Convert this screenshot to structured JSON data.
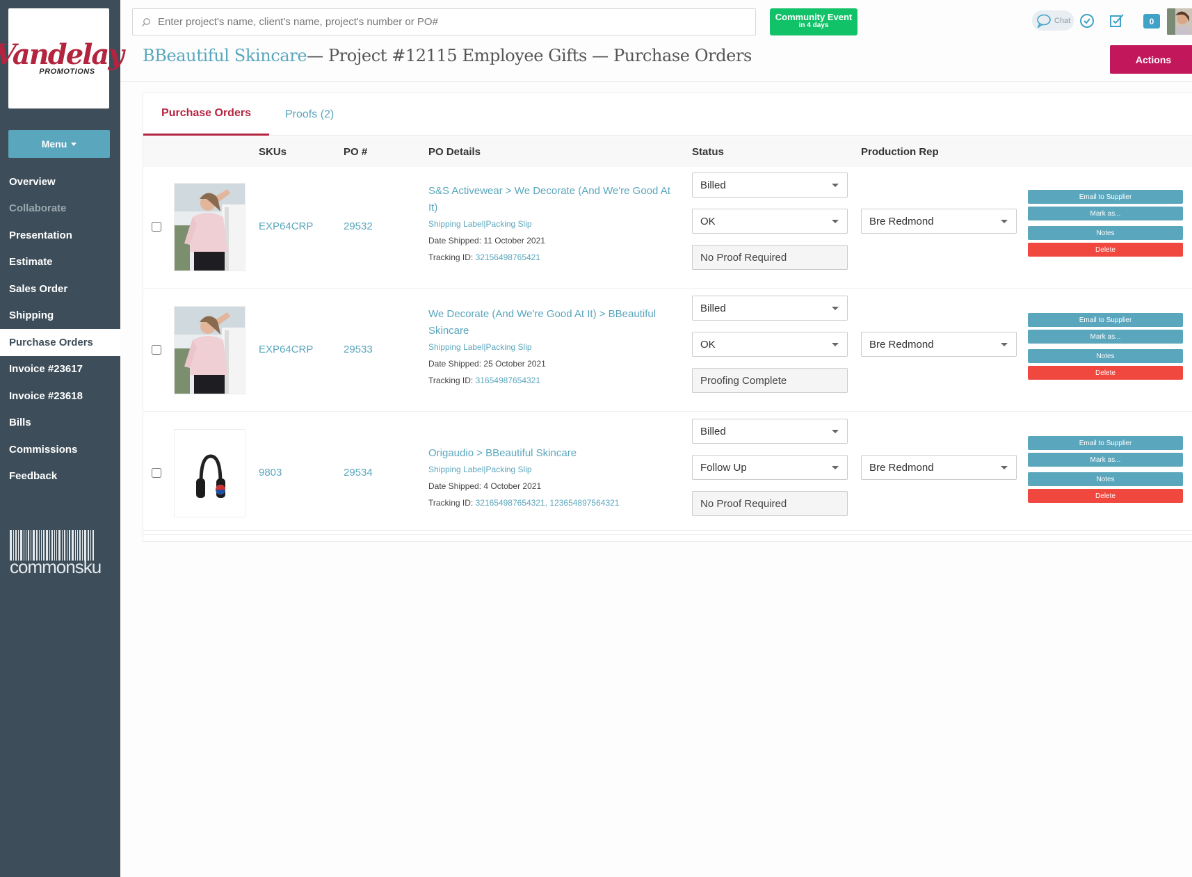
{
  "sidebar": {
    "logo_main": "Vandelay",
    "logo_sub": "PROMOTIONS",
    "menu_label": "Menu",
    "items": [
      {
        "label": "Overview",
        "state": "normal"
      },
      {
        "label": "Collaborate",
        "state": "disabled"
      },
      {
        "label": "Presentation",
        "state": "normal"
      },
      {
        "label": "Estimate",
        "state": "normal"
      },
      {
        "label": "Sales Order",
        "state": "normal"
      },
      {
        "label": "Shipping",
        "state": "normal"
      },
      {
        "label": "Purchase Orders",
        "state": "active"
      },
      {
        "label": "Invoice #23617",
        "state": "normal"
      },
      {
        "label": "Invoice #23618",
        "state": "normal"
      },
      {
        "label": "Bills",
        "state": "normal"
      },
      {
        "label": "Commissions",
        "state": "normal"
      },
      {
        "label": "Feedback",
        "state": "normal"
      }
    ],
    "brand": "commonsku"
  },
  "topbar": {
    "search_placeholder": "Enter project's name, client's name, project's number or PO#",
    "community_title": "Community Event",
    "community_sub": "in 4 days",
    "chat_label": "Chat",
    "notification_count": "0"
  },
  "page": {
    "client": "BBeautiful Skincare",
    "title_rest": "— Project #12115 Employee Gifts — Purchase Orders",
    "actions_label": "Actions"
  },
  "tabs": [
    {
      "label": "Purchase Orders",
      "active": true
    },
    {
      "label": "Proofs (2)",
      "active": false
    }
  ],
  "table": {
    "headers": {
      "skus": "SKUs",
      "po": "PO #",
      "details": "PO Details",
      "status": "Status",
      "rep": "Production Rep"
    },
    "rows": [
      {
        "sku": "EXP64CRP",
        "po": "29532",
        "title": "S&S Activewear > We Decorate (And We're Good At It)",
        "labels": "Shipping Label|Packing Slip",
        "date_shipped_label": "Date Shipped:",
        "date_shipped": "11 October 2021",
        "tracking_label": "Tracking ID:",
        "tracking": "32156498765421",
        "billing_status": "Billed",
        "status": "OK",
        "proof": "No Proof Required",
        "rep": "Bre Redmond",
        "thumb": "shirt"
      },
      {
        "sku": "EXP64CRP",
        "po": "29533",
        "title": "We Decorate (And We're Good At It) > BBeautiful Skincare",
        "labels": "Shipping Label|Packing Slip",
        "date_shipped_label": "Date Shipped:",
        "date_shipped": "25 October 2021",
        "tracking_label": "Tracking ID:",
        "tracking": "31654987654321",
        "billing_status": "Billed",
        "status": "OK",
        "proof": "Proofing Complete",
        "rep": "Bre Redmond",
        "thumb": "shirt"
      },
      {
        "sku": "9803",
        "po": "29534",
        "title": "Origaudio > BBeautiful Skincare",
        "labels": "Shipping Label|Packing Slip",
        "date_shipped_label": "Date Shipped:",
        "date_shipped": "4 October 2021",
        "tracking_label": "Tracking ID:",
        "tracking": "321654987654321, 123654897564321",
        "billing_status": "Billed",
        "status": "Follow Up",
        "proof": "No Proof Required",
        "rep": "Bre Redmond",
        "thumb": "headphones"
      }
    ],
    "row_actions": {
      "email": "Email to Supplier",
      "mark": "Mark as...",
      "notes": "Notes",
      "delete": "Delete"
    }
  },
  "colors": {
    "sidebar_bg": "#3d4e5a",
    "accent_teal": "#5aa6bd",
    "brand_red": "#b3243f",
    "actions_button": "#c2185b",
    "delete_red": "#f0473f",
    "community_green": "#12c268"
  }
}
